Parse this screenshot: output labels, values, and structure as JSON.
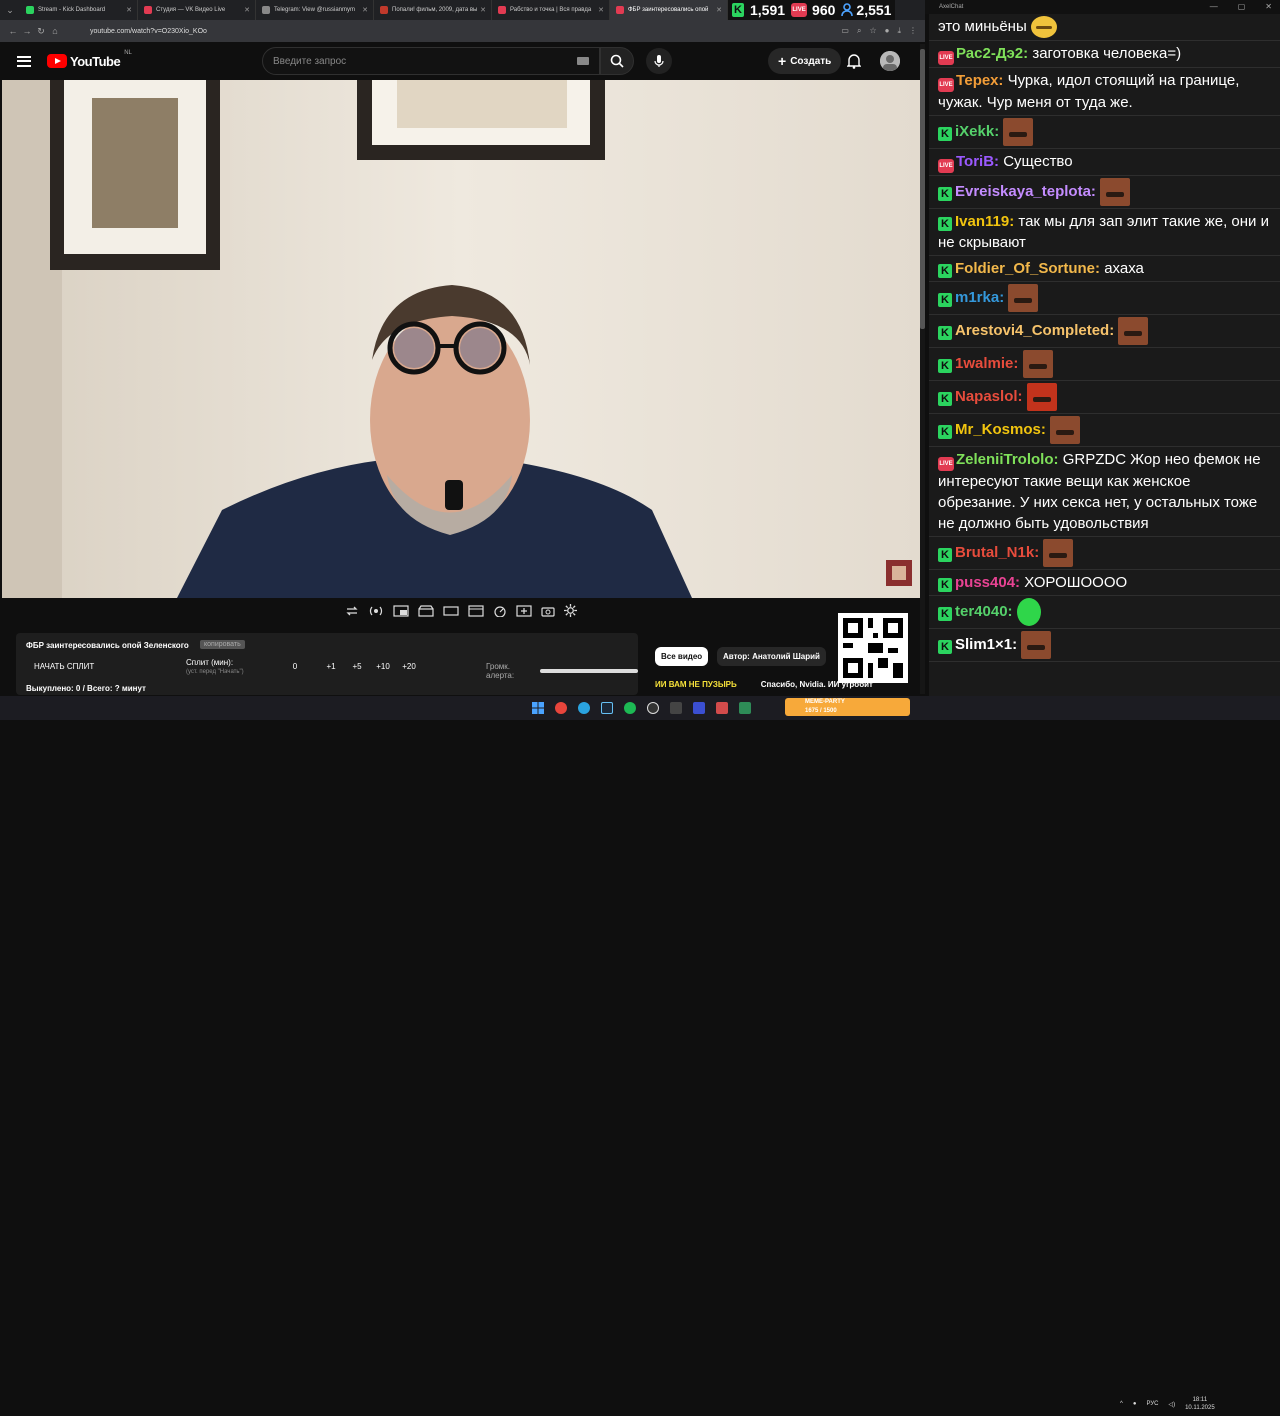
{
  "browser": {
    "tabs": [
      {
        "label": "Stream - Kick Dashboard",
        "color": "#2bd45f"
      },
      {
        "label": "Студия — VK Видео Live",
        "color": "#e23b52"
      },
      {
        "label": "Telegram: View @russianmym",
        "color": "#888888"
      },
      {
        "label": "Попали! фильм, 2009, дата вы",
        "color": "#c0392b"
      },
      {
        "label": "Рабство и точка | Вся правда",
        "color": "#e23b52"
      },
      {
        "label": "ФБР заинтересовались опой",
        "color": "#e23b52"
      }
    ],
    "url": "youtube.com/watch?v=O230Xio_KOo"
  },
  "stats": {
    "kick_viewers": "1,591",
    "vk_viewers": "960",
    "total_viewers": "2,551",
    "live_label": "LIVE"
  },
  "youtube": {
    "logo_text": "YouTube",
    "region": "NL",
    "search_placeholder": "Введите запрос",
    "create_label": "Создать"
  },
  "panel": {
    "video_title": "ФБР заинтересовались опой Зеленского",
    "chip": "копировать",
    "start_split": "НАЧАТЬ СПЛИТ",
    "split_label": "Сплит (мин):",
    "split_hint": "(уст. перед \"Начать\")",
    "split_value": "0",
    "plus_buttons": [
      "+1",
      "+5",
      "+10",
      "+20"
    ],
    "volume_label": "Громк. алерта:",
    "sold": "Выкуплено: 0 / Всего: ? минут"
  },
  "side": {
    "all_videos": "Все видео",
    "author": "Автор: Анатолий Шарий",
    "rec1": "ИИ ВАМ НЕ ПУЗЫРЬ",
    "rec2": "Спасибо, Nvidia. ИИ угробит"
  },
  "chat": {
    "window_title": "AxelChat",
    "messages": [
      {
        "platform": "",
        "nick": "",
        "nick_color": "#ffffff",
        "text": "это миньёны",
        "emote": "yellow"
      },
      {
        "platform": "vk",
        "nick": "Рас2-Дэ2:",
        "nick_color": "#7fe05a",
        "text": "заготовка человека=)",
        "emote": ""
      },
      {
        "platform": "vk",
        "nick": "Терех:",
        "nick_color": "#f29d38",
        "text": "Чурка, идол стоящий на границе, чужак. Чур меня от туда же.",
        "emote": ""
      },
      {
        "platform": "kick",
        "nick": "iXekk:",
        "nick_color": "#55d16b",
        "text": "",
        "emote": "face"
      },
      {
        "platform": "vk",
        "nick": "ToriB:",
        "nick_color": "#9b59ff",
        "text": "Существо",
        "emote": ""
      },
      {
        "platform": "kick",
        "nick": "Evreiskaya_teplota:",
        "nick_color": "#c48cff",
        "text": "",
        "emote": "face"
      },
      {
        "platform": "kick",
        "nick": "Ivan119:",
        "nick_color": "#f1c40f",
        "text": "так мы для зап элит такие же, они и не скрывают",
        "emote": ""
      },
      {
        "platform": "kick",
        "nick": "Foldier_Of_Sortune:",
        "nick_color": "#f2b84b",
        "text": "ахаха",
        "emote": ""
      },
      {
        "platform": "kick",
        "nick": "m1rka:",
        "nick_color": "#3498db",
        "text": "",
        "emote": "face"
      },
      {
        "platform": "kick",
        "nick": "Arestovi4_Completed:",
        "nick_color": "#f5c26b",
        "text": "",
        "emote": "face"
      },
      {
        "platform": "kick",
        "nick": "1walmie:",
        "nick_color": "#e74c3c",
        "text": "",
        "emote": "face"
      },
      {
        "platform": "kick",
        "nick": "Napaslol:",
        "nick_color": "#e74c3c",
        "text": "",
        "emote": "red"
      },
      {
        "platform": "kick",
        "nick": "Mr_Kosmos:",
        "nick_color": "#f1c40f",
        "text": "",
        "emote": "face"
      },
      {
        "platform": "vk",
        "nick": "ZeleniiTrololo:",
        "nick_color": "#7fe05a",
        "text": "GRPZDC Жор нео фемок не интересуют такие вещи как женское обрезание. У них секса нет, у остальных тоже не должно быть удовольствия",
        "emote": ""
      },
      {
        "platform": "kick",
        "nick": "Brutal_N1k:",
        "nick_color": "#e74c3c",
        "text": "",
        "emote": "face"
      },
      {
        "platform": "kick",
        "nick": "puss404:",
        "nick_color": "#e84393",
        "text": "ХОРОШОООО",
        "emote": ""
      },
      {
        "platform": "kick",
        "nick": "ter4040:",
        "nick_color": "#55d16b",
        "text": "",
        "emote": "green"
      },
      {
        "platform": "kick",
        "nick": "Slim1×1:",
        "nick_color": "#ffffff",
        "text": "",
        "emote": "face"
      }
    ]
  },
  "taskbar": {
    "meme_label": "MEME-PARTY",
    "meme_progress": "1675 / 1500",
    "lang": "РУС",
    "time": "18:11",
    "date": "10.11.2025"
  }
}
